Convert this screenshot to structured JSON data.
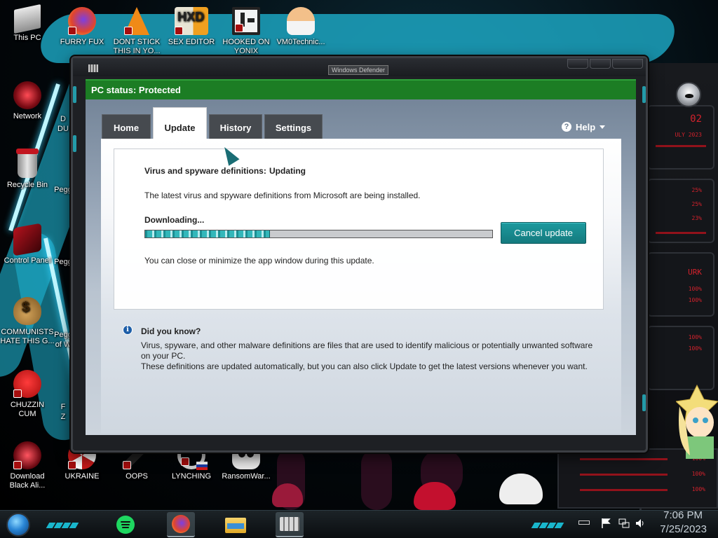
{
  "desktop": {
    "icons": [
      {
        "label": "This PC",
        "name": "desktop-icon-this-pc"
      },
      {
        "label": "FURRY FUX",
        "name": "desktop-icon-furry-fux"
      },
      {
        "label": "DONT STICK THIS IN YO...",
        "name": "desktop-icon-dont-stick"
      },
      {
        "label": "SEX EDITOR",
        "name": "desktop-icon-sex-editor"
      },
      {
        "label": "HOOKED ON YONIX",
        "name": "desktop-icon-hooked-on-yonix"
      },
      {
        "label": "VM0Technic...",
        "name": "desktop-icon-vm0technic"
      },
      {
        "label": "Network",
        "name": "desktop-icon-network"
      },
      {
        "label": "Recycle Bin",
        "name": "desktop-icon-recycle-bin"
      },
      {
        "label": "Control Panel",
        "name": "desktop-icon-control-panel"
      },
      {
        "label": "COMMUNISTS HATE THIS G...",
        "name": "desktop-icon-communists"
      },
      {
        "label": "CHUZZIN CUM",
        "name": "desktop-icon-chuzzin"
      },
      {
        "label": "Download Black Ali...",
        "name": "desktop-icon-download-black-ali"
      },
      {
        "label": "UKRAINE",
        "name": "desktop-icon-ukraine"
      },
      {
        "label": "OOPS",
        "name": "desktop-icon-oops"
      },
      {
        "label": "LYNCHING",
        "name": "desktop-icon-lynching"
      },
      {
        "label": "RansomWar...",
        "name": "desktop-icon-ransomware"
      }
    ],
    "partial_labels": [
      "D",
      "DU",
      "Pegg",
      "Pegg",
      "Pegg",
      "of W",
      "F",
      "Z"
    ]
  },
  "window": {
    "title": "Windows Defender",
    "status": "PC status: Protected",
    "status_color": "#1c7d24",
    "tabs": [
      {
        "label": "Home",
        "active": false
      },
      {
        "label": "Update",
        "active": true
      },
      {
        "label": "History",
        "active": false
      },
      {
        "label": "Settings",
        "active": false
      }
    ],
    "help_label": "Help",
    "help_icon": "question-icon",
    "update": {
      "definitions_label": "Virus and spyware definitions:",
      "definitions_status": "Updating",
      "description": "The latest virus and spyware definitions from Microsoft are being installed.",
      "progress_label": "Downloading...",
      "progress_fraction": 0.36,
      "cancel_button": "Cancel update",
      "close_note": "You can close or minimize the app window during this update."
    },
    "did_you_know": {
      "heading": "Did you know?",
      "line1": "Virus, spyware, and other malware definitions are files that are used to identify malicious or potentially unwanted software",
      "line2": "on your PC.",
      "line3": "These definitions are updated automatically, but you can also click Update to get the latest versions whenever you want."
    },
    "accent_color": "#1d9a9e"
  },
  "hud": {
    "texts": [
      "02",
      "ULY 2023",
      "25%",
      "25%",
      "23%",
      "URK",
      "100%",
      "100%",
      "100%",
      "100%",
      "100%",
      "100%",
      "100%"
    ]
  },
  "taskbar": {
    "apps": [
      "spotify-icon",
      "firefox-icon",
      "file-explorer-icon",
      "windows-defender-icon"
    ],
    "tray_icons": [
      "flag-icon",
      "network-icon",
      "volume-icon"
    ],
    "clock_time": "7:06 PM",
    "clock_date": "7/25/2023"
  }
}
